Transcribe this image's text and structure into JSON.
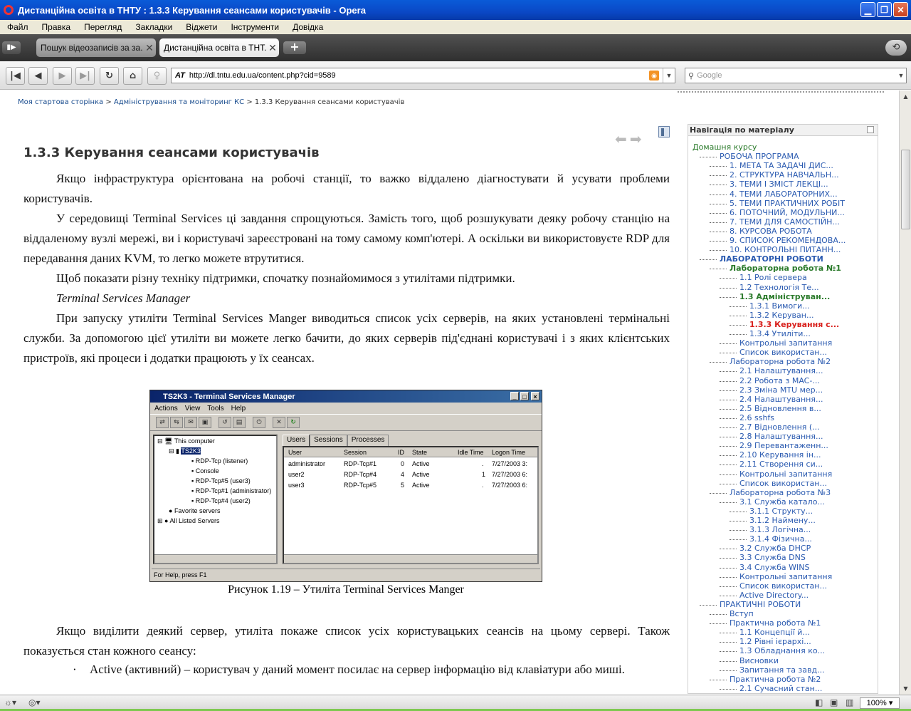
{
  "window": {
    "title": "Дистанційна освіта в ТНТУ : 1.3.3 Керування сеансами користувачів - Opera"
  },
  "menu": [
    "Файл",
    "Правка",
    "Перегляд",
    "Закладки",
    "Віджети",
    "Інструменти",
    "Довідка"
  ],
  "tabs": [
    {
      "label": "Пошук відеозаписів за за..."
    },
    {
      "label": "Дистанційна освіта в ТНТ..."
    }
  ],
  "address": {
    "url": "http://dl.tntu.edu.ua/content.php?cid=9589"
  },
  "search": {
    "placeholder": "Google"
  },
  "breadcrumb": {
    "home": "Моя стартова сторінка",
    "sep1": " > ",
    "course": "Адміністрування та моніторинг КС",
    "sep2": " > ",
    "current": "1.3.3 Керування сеансами користувачів"
  },
  "page": {
    "title": "1.3.3 Керування сеансами користувачів",
    "p1": "Якщо інфраструктура орієнтована на робочі станції, то важко віддалено діагностувати й усувати проблеми користувачів.",
    "p2": "У середовищі Terminal Services ці завдання спрощуються. Замість того, щоб розшукувати деяку робочу станцію на віддаленому вузлі мережі, ви і користувачі зареєстровані на тому самому комп'ютері. А оскільки ви використовуєте RDP для передавання даних KVM, то легко можете втрутитися.",
    "p3": "Щоб показати різну техніку підтримки, спочатку познайомимося з утилітами підтримки.",
    "p4": "Terminal Services Manager",
    "p5": "При запуску утиліти Terminal Services Manger виводиться список усіх серверів, на яких установлені термінальні служби. За допомогою цієї утиліти ви можете легко бачити, до яких серверів під'єднані користувачі і з яких клієнтських пристроїв, які процеси і додатки працюють у їх сеансах.",
    "caption": "Рисунок 1.19 – Утиліта Terminal Services Manger",
    "p6": "Якщо виділити деякий сервер, утиліта покаже список усіх користувацьких сеансів на цьому сервері. Також показується стан кожного сеансу:",
    "bullet1": "Active (активний) – користувач у даний момент посилає на сервер інформацію від клавіатури або миші."
  },
  "tsm": {
    "title": "TS2K3 - Terminal Services Manager",
    "menu": [
      "Actions",
      "View",
      "Tools",
      "Help"
    ],
    "tree": [
      "This computer",
      "TS2K3",
      "RDP-Tcp (listener)",
      "Console",
      "RDP-Tcp#5 (user3)",
      "RDP-Tcp#1 (administrator)",
      "RDP-Tcp#4 (user2)",
      "Favorite servers",
      "All Listed Servers"
    ],
    "tabs": [
      "Users",
      "Sessions",
      "Processes"
    ],
    "columns": [
      "User",
      "Session",
      "ID",
      "State",
      "Idle Time",
      "Logon Time"
    ],
    "rows": [
      [
        "administrator",
        "RDP-Tcp#1",
        "0",
        "Active",
        ".",
        "7/27/2003 3:"
      ],
      [
        "user2",
        "RDP-Tcp#4",
        "4",
        "Active",
        "1",
        "7/27/2003 6:"
      ],
      [
        "user3",
        "RDP-Tcp#5",
        "5",
        "Active",
        ".",
        "7/27/2003 6:"
      ]
    ],
    "status": "For Help, press F1"
  },
  "nav": {
    "header": "Навігація по матеріалу",
    "items": [
      "Домашня курсу",
      "РОБОЧА ПРОГРАМА",
      "1. МЕТА ТА ЗАДАЧІ ДИС...",
      "2. СТРУКТУРА НАВЧАЛЬН...",
      "3. ТЕМИ І ЗМІСТ ЛЕКЦІ...",
      "4. ТЕМИ ЛАБОРАТОРНИХ...",
      "5. ТЕМИ ПРАКТИЧНИХ РОБІТ",
      "6. ПОТОЧНИЙ, МОДУЛЬНИ...",
      "7. ТЕМИ ДЛЯ САМОСТІЙН...",
      "8. КУРСОВА РОБОТА",
      "9. СПИСОК РЕКОМЕНДОВА...",
      "10. КОНТРОЛЬНІ ПИТАНН...",
      "ЛАБОРАТОРНІ РОБОТИ",
      "Лабораторна робота №1",
      "1.1 Ролі сервера",
      "1.2 Технологія Те...",
      "1.3 Адмініструван...",
      "1.3.1 Вимоги...",
      "1.3.2 Керуван...",
      "1.3.3 Керування с...",
      "1.3.4 Утиліти...",
      "Контрольні запитання",
      "Список використан...",
      "Лабораторна робота №2",
      "2.1 Налаштування...",
      "2.2 Робота з MAC-...",
      "2.3 Зміна MTU мер...",
      "2.4 Налаштування...",
      "2.5 Відновлення в...",
      "2.6 sshfs",
      "2.7 Відновлення (...",
      "2.8 Налаштування...",
      "2.9 Перевантаженн...",
      "2.10 Керування ін...",
      "2.11 Створення си...",
      "Контрольні запитання",
      "Список використан...",
      "Лабораторна робота №3",
      "3.1 Служба катало...",
      "3.1.1 Структу...",
      "3.1.2 Наймену...",
      "3.1.3 Логічна...",
      "3.1.4 Фізична...",
      "3.2 Служба DHCP",
      "3.3 Служба DNS",
      "3.4 Служба WINS",
      "Контрольні запитання",
      "Список використан...",
      "Active Directory...",
      "ПРАКТИЧНІ РОБОТИ",
      "Вступ",
      "Практична робота №1",
      "1.1 Концепції й...",
      "1.2 Рівні ієрархі...",
      "1.3 Обладнання ко...",
      "Висновки",
      "Запитання та завд...",
      "Практична робота №2",
      "2.1 Сучасний стан..."
    ]
  },
  "status": {
    "zoom": "100%"
  }
}
